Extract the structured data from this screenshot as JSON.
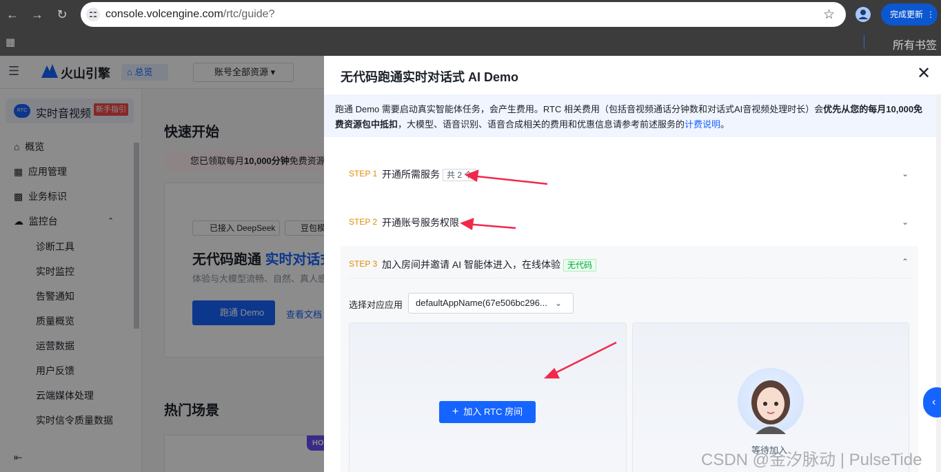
{
  "browser": {
    "url_host": "console.volcengine.com",
    "url_path": "/rtc/guide?",
    "update_button": "完成更新",
    "bookmarks_label": "所有书签"
  },
  "page": {
    "brand": "火山引擎",
    "nav_home": "总览",
    "nav_account": "账号全部资源",
    "product": "实时音视频",
    "product_badge": "新手指引",
    "sidebar": [
      {
        "label": "概览"
      },
      {
        "label": "应用管理"
      },
      {
        "label": "业务标识"
      },
      {
        "label": "监控台"
      }
    ],
    "sidebar_sub": [
      "诊断工具",
      "实时监控",
      "告警通知",
      "质量概览",
      "运营数据",
      "用户反馈",
      "云端媒体处理",
      "实时信令质量数据"
    ],
    "quick_start": "快速开始",
    "free_notice": "您已领取每月",
    "free_notice_bold": "10,000分钟",
    "free_notice_rest": "免费资源",
    "tag_deepseek": "已接入 DeepSeek",
    "tag_doubao": "豆包模",
    "hero_title": "无代码跑通",
    "hero_title_blue": "实时对话式",
    "hero_sub": "体验与大模型流畅、自然、真人感",
    "hero_btn": "跑通 Demo",
    "hero_link": "查看文档",
    "hot_scenes": "热门场景",
    "hot_badge": "HO"
  },
  "drawer": {
    "title": "无代码跑通实时对话式 AI Demo",
    "notice_pre": "跑通 Demo 需要启动真实智能体任务，会产生费用。RTC 相关费用（包括音视频通话分钟数和对话式AI音视频处理时长）会",
    "notice_bold": "优先从您的每月10,000免费资源包中抵扣",
    "notice_post": "，大模型、语音识别、语音合成相关的费用和优惠信息请参考前述服务的",
    "notice_link": "计费说明",
    "notice_end": "。",
    "steps": [
      {
        "no": "STEP 1",
        "title": "开通所需服务",
        "tag": "共 2 个"
      },
      {
        "no": "STEP 2",
        "title": "开通账号服务权限",
        "tag": ""
      },
      {
        "no": "STEP 3",
        "title": "加入房间并邀请 AI 智能体进入，在线体验",
        "tag": "无代码"
      }
    ],
    "select_label": "选择对应应用",
    "select_value": "defaultAppName(67e506bc296...",
    "join_button": "加入 RTC 房间",
    "waiting": "等待加入"
  },
  "watermark": "CSDN @金汐脉动 | PulseTide",
  "colors": {
    "accent": "#1664ff",
    "step": "#e08a00",
    "arrow": "#f0284a"
  }
}
